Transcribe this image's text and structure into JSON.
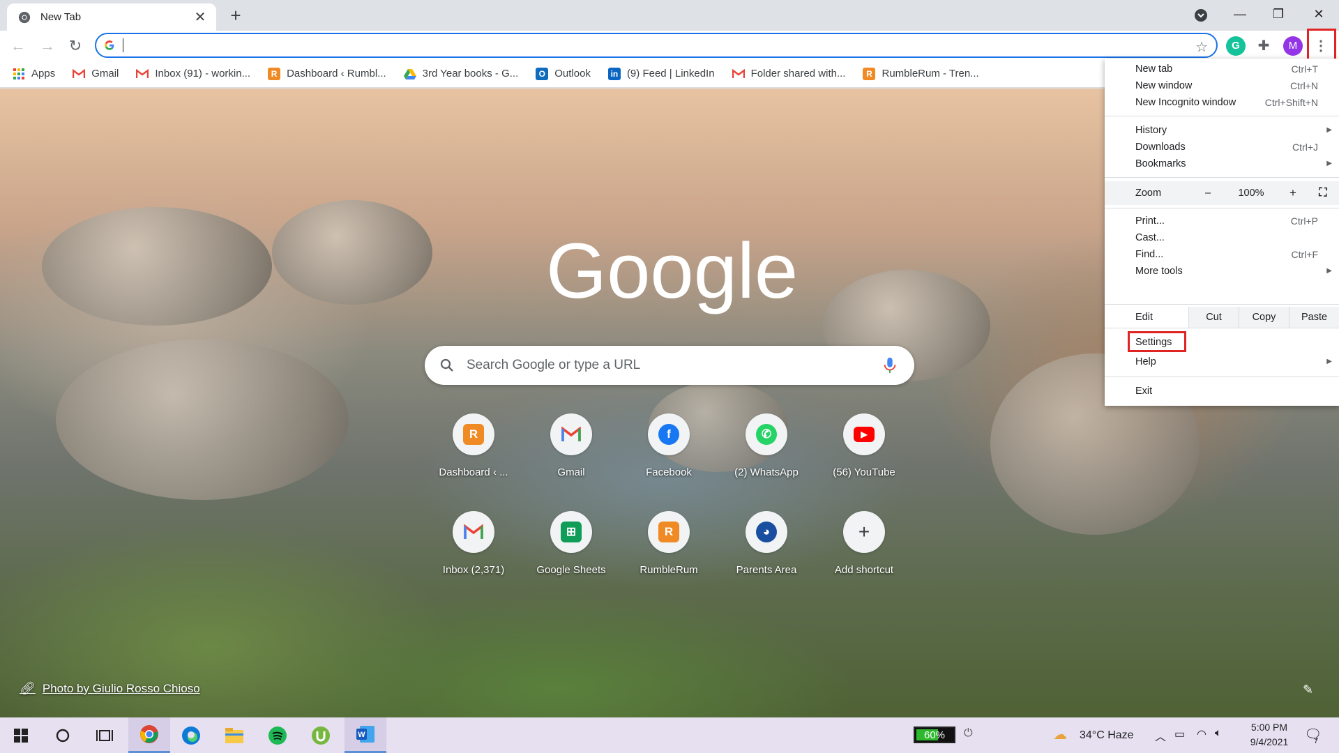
{
  "tab": {
    "title": "New Tab"
  },
  "toolbar": {
    "avatar_letter": "M"
  },
  "bookmarks": [
    {
      "label": "Apps",
      "icon": "apps-grid-icon",
      "color": "#ea4335"
    },
    {
      "label": "Gmail",
      "icon": "gmail-icon",
      "color": "#ea4335"
    },
    {
      "label": "Inbox (91) - workin...",
      "icon": "gmail-icon",
      "color": "#ea4335"
    },
    {
      "label": "Dashboard ‹ Rumbl...",
      "icon": "rumblerum-icon",
      "color": "#f08a24"
    },
    {
      "label": "3rd Year books - G...",
      "icon": "google-drive-icon",
      "color": "#34a853"
    },
    {
      "label": "Outlook",
      "icon": "outlook-icon",
      "color": "#0f6cbd"
    },
    {
      "label": "(9) Feed | LinkedIn",
      "icon": "linkedin-icon",
      "color": "#0a66c2"
    },
    {
      "label": "Folder shared with...",
      "icon": "gmail-icon",
      "color": "#ea4335"
    },
    {
      "label": "RumbleRum - Tren...",
      "icon": "rumblerum-icon",
      "color": "#f08a24"
    }
  ],
  "ntp": {
    "logo_text": "Google",
    "search_placeholder": "Search Google or type a URL",
    "shortcuts": [
      {
        "label": "Dashboard ‹ ...",
        "icon": "rumblerum-icon",
        "color": "#f08a24"
      },
      {
        "label": "Gmail",
        "icon": "gmail-icon",
        "color": "#ea4335"
      },
      {
        "label": "Facebook",
        "icon": "facebook-icon",
        "color": "#1877f2"
      },
      {
        "label": "(2) WhatsApp",
        "icon": "whatsapp-icon",
        "color": "#25d366"
      },
      {
        "label": "(56) YouTube",
        "icon": "youtube-icon",
        "color": "#ff0000"
      },
      {
        "label": "Inbox (2,371)",
        "icon": "gmail-icon",
        "color": "#ea4335"
      },
      {
        "label": "Google Sheets",
        "icon": "google-sheets-icon",
        "color": "#0f9d58"
      },
      {
        "label": "RumbleRum",
        "icon": "rumblerum-icon",
        "color": "#f08a24"
      },
      {
        "label": "Parents Area",
        "icon": "parents-area-icon",
        "color": "#1a4fa0"
      },
      {
        "label": "Add shortcut",
        "icon": "plus-icon",
        "color": "#3c4043"
      }
    ],
    "attribution": "Photo by Giulio Rosso Chioso"
  },
  "menu": {
    "new_tab": "New tab",
    "new_tab_sc": "Ctrl+T",
    "new_window": "New window",
    "new_window_sc": "Ctrl+N",
    "incognito": "New Incognito window",
    "incognito_sc": "Ctrl+Shift+N",
    "history": "History",
    "downloads": "Downloads",
    "downloads_sc": "Ctrl+J",
    "bookmarks": "Bookmarks",
    "zoom": "Zoom",
    "zoom_minus": "–",
    "zoom_value": "100%",
    "zoom_plus": "+",
    "print": "Print...",
    "print_sc": "Ctrl+P",
    "cast": "Cast...",
    "find": "Find...",
    "find_sc": "Ctrl+F",
    "more_tools": "More tools",
    "edit": "Edit",
    "cut": "Cut",
    "copy": "Copy",
    "paste": "Paste",
    "settings": "Settings",
    "help": "Help",
    "exit": "Exit"
  },
  "taskbar": {
    "battery": "60%",
    "battery_level": 0.6,
    "weather": "34°C  Haze",
    "time": "5:00 PM",
    "date": "9/4/2021",
    "notification_count": "7"
  },
  "colors": {
    "accent": "#1a73e8",
    "highlight": "#e02424"
  }
}
